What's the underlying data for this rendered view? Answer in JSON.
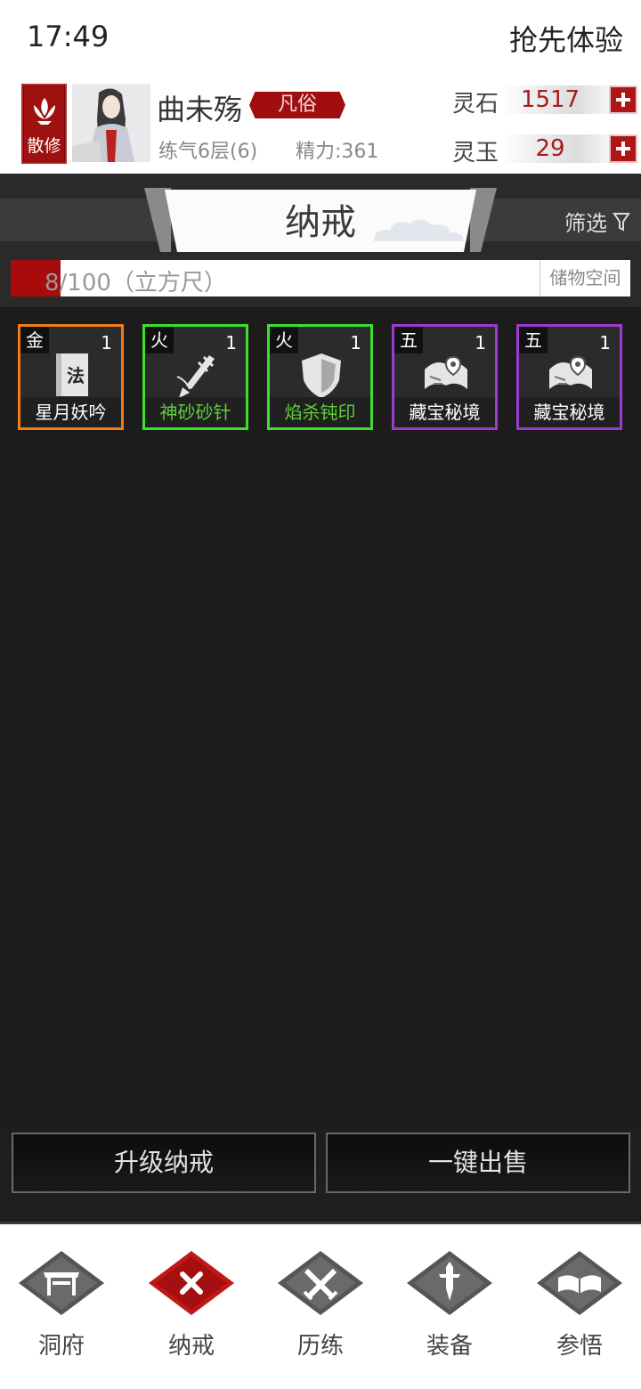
{
  "status_bar": {
    "time": "17:49",
    "right_text": "抢先体验"
  },
  "player": {
    "sect": "散修",
    "name": "曲未殇",
    "rank": "凡俗",
    "realm": "练气6层(6)",
    "energy": "精力:361"
  },
  "currencies": [
    {
      "label": "灵石",
      "value": "1517",
      "icon": "plus-icon"
    },
    {
      "label": "灵玉",
      "value": "29",
      "icon": "plus-icon"
    }
  ],
  "panel": {
    "title": "纳戒",
    "filter_label": "筛选",
    "capacity_used": "8",
    "capacity_text": "8/100（立方尺）",
    "capacity_fraction": 0.08,
    "storage_label": "储物空间"
  },
  "items": [
    {
      "element": "金",
      "count": "1",
      "name": "星月妖吟",
      "icon": "manual-book-icon",
      "border_color": "#f07d1a",
      "name_color": "#ffffff"
    },
    {
      "element": "火",
      "count": "1",
      "name": "神砂砂针",
      "icon": "needle-weapon-icon",
      "border_color": "#3ddf2c",
      "name_color": "#5fcf3a"
    },
    {
      "element": "火",
      "count": "1",
      "name": "焰杀钝印",
      "icon": "shield-icon",
      "border_color": "#3ddf2c",
      "name_color": "#5fcf3a"
    },
    {
      "element": "五",
      "count": "1",
      "name": "藏宝秘境",
      "icon": "treasure-map-icon",
      "border_color": "#9b3bd0",
      "name_color": "#ffffff"
    },
    {
      "element": "五",
      "count": "1",
      "name": "藏宝秘境",
      "icon": "treasure-map-icon",
      "border_color": "#9b3bd0",
      "name_color": "#ffffff"
    }
  ],
  "actions": {
    "upgrade": "升级纳戒",
    "sell_all": "一键出售"
  },
  "nav": [
    {
      "label": "洞府",
      "icon": "cave-gate-icon",
      "active": false
    },
    {
      "label": "纳戒",
      "icon": "ring-close-icon",
      "active": true
    },
    {
      "label": "历练",
      "icon": "crossed-swords-icon",
      "active": false
    },
    {
      "label": "装备",
      "icon": "dagger-icon",
      "active": false
    },
    {
      "label": "参悟",
      "icon": "open-book-icon",
      "active": false
    }
  ],
  "colors": {
    "accent_red": "#a70b0b",
    "orange": "#f07d1a",
    "green": "#3ddf2c",
    "purple": "#9b3bd0"
  }
}
